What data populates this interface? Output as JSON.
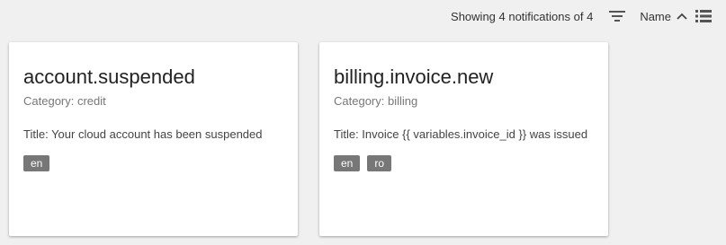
{
  "toolbar": {
    "count_text": "Showing 4 notifications of 4",
    "sort_label": "Name",
    "filter_icon": "filter-list-icon",
    "sort_icon": "chevron-up-icon",
    "view_icon": "list-view-icon"
  },
  "cards": [
    {
      "title": "account.suspended",
      "category": "Category: credit",
      "message": "Title: Your cloud account has been suspended",
      "languages": [
        "en"
      ]
    },
    {
      "title": "billing.invoice.new",
      "category": "Category: billing",
      "message": "Title: Invoice {{ variables.invoice_id }} was issued",
      "languages": [
        "en",
        "ro"
      ]
    }
  ],
  "colors": {
    "background": "#f0f0f0",
    "card": "#ffffff",
    "badge": "#777777"
  }
}
